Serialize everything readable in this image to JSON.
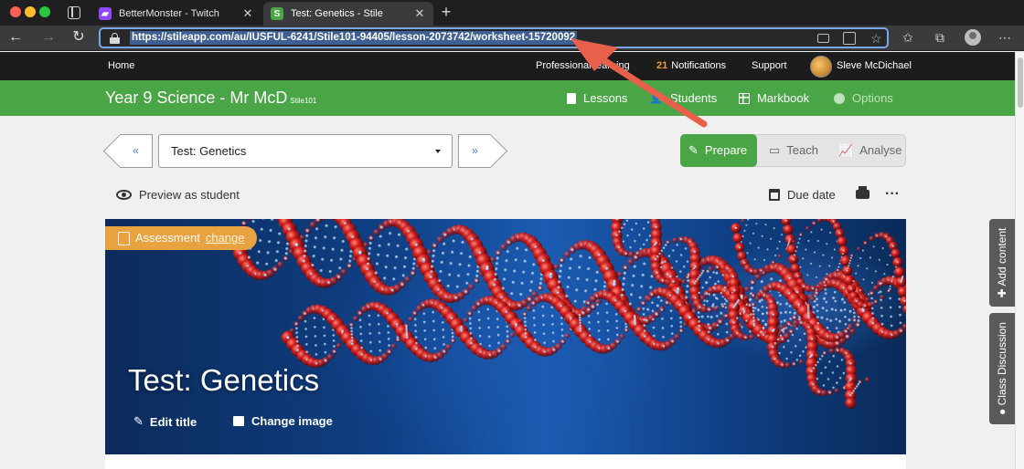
{
  "browser": {
    "tabs": [
      {
        "title": "BetterMonster - Twitch",
        "favicon": "twitch-icon",
        "active": false
      },
      {
        "title": "Test: Genetics - Stile",
        "favicon": "stile-icon",
        "active": true
      }
    ],
    "close_glyph": "✕",
    "new_tab_glyph": "+",
    "url": "https://stileapp.com/au/IUSFUL-6241/Stile101-94405/lesson-2073742/worksheet-15720092",
    "stile_favicon_letter": "S"
  },
  "site_nav": {
    "home": "Home",
    "professional": "Professional learning",
    "notifications_count": "21",
    "notifications_label": "Notifications",
    "support": "Support",
    "user_name": "Sleve McDichael"
  },
  "class_bar": {
    "title": "Year 9 Science - Mr McD",
    "code": "Stile101",
    "links": {
      "lessons": "Lessons",
      "students": "Students",
      "markbook": "Markbook",
      "options": "Options"
    }
  },
  "lesson_controls": {
    "prev": "«",
    "next": "»",
    "selected_lesson": "Test: Genetics",
    "modes": {
      "prepare": "Prepare",
      "teach": "Teach",
      "analyse": "Analyse"
    },
    "active_mode": "Prepare",
    "preview": "Preview as student",
    "due_date": "Due date",
    "more": "···"
  },
  "hero": {
    "badge": "Assessment",
    "badge_link": "change",
    "title": "Test: Genetics",
    "edit_title": "Edit title",
    "change_image": "Change image"
  },
  "side_tabs": {
    "add_content": "Add content",
    "class_discussion": "Class Discussion"
  },
  "colors": {
    "brand_green": "#4aa546",
    "assessment_orange": "#e8a23f",
    "notification_orange": "#f19a3e",
    "annotation_arrow": "#e8604a"
  }
}
